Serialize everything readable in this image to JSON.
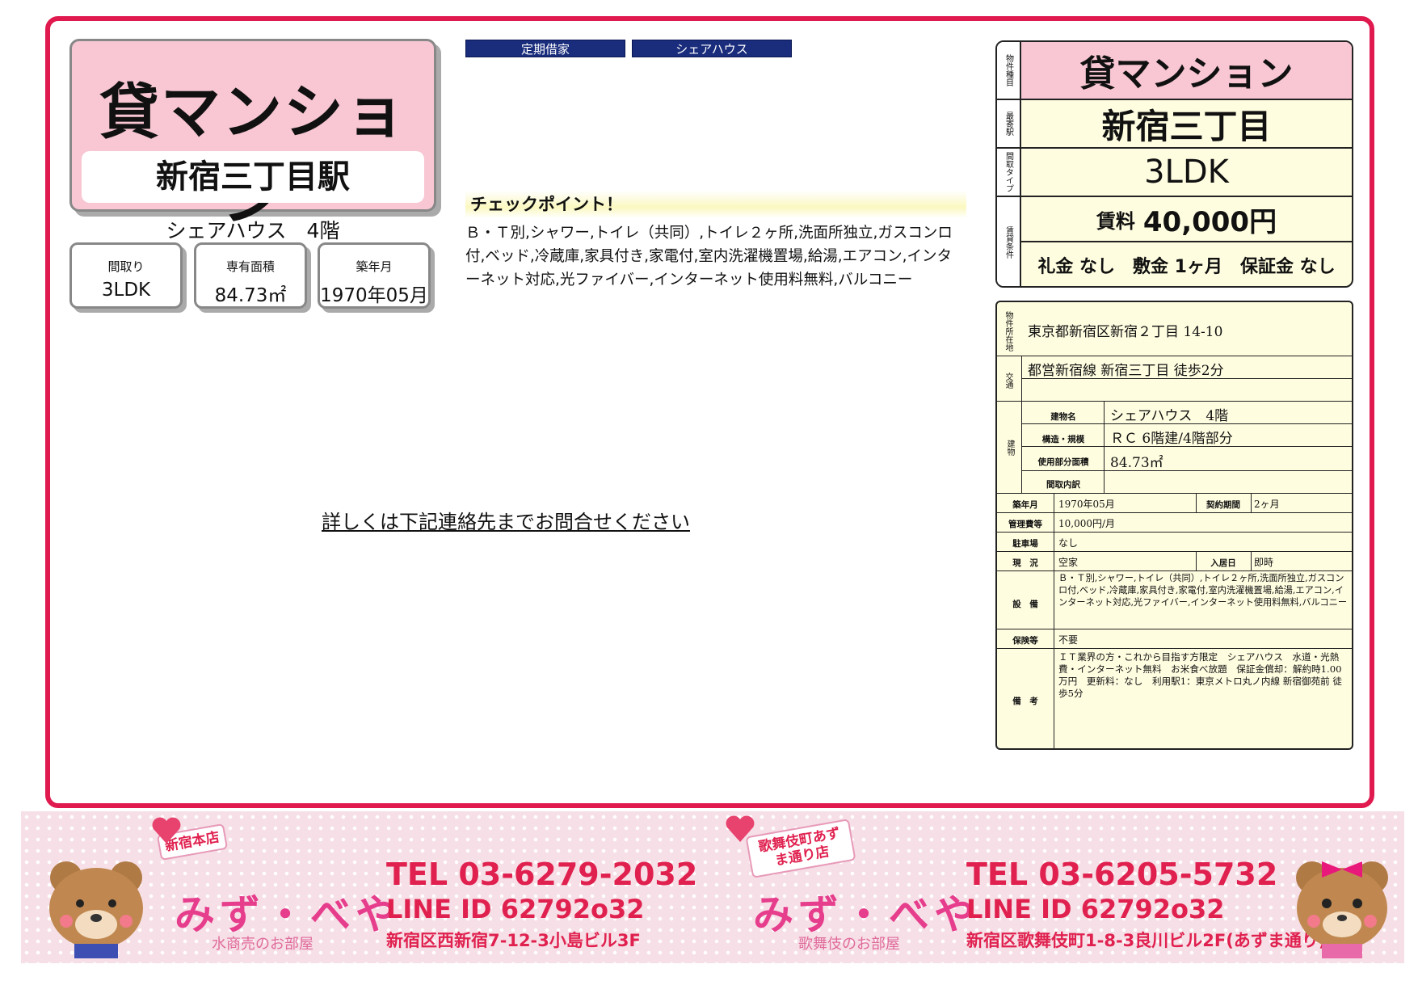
{
  "title": {
    "type": "貸マンション",
    "station": "新宿三丁目駅",
    "subtitle": "シェアハウス　4階"
  },
  "summary_boxes": [
    {
      "label": "間取り",
      "value": "3LDK"
    },
    {
      "label": "専有面積",
      "value": "84.73㎡"
    },
    {
      "label": "築年月",
      "value": "1970年05月"
    }
  ],
  "tags": [
    "定期借家",
    "シェアハウス"
  ],
  "checkpoint": {
    "heading": "チェックポイント！",
    "text": "Ｂ・Ｔ別,シャワー,トイレ（共同）,トイレ２ヶ所,洗面所独立,ガスコンロ付,ベッド,冷蔵庫,家具付き,家電付,室内洗濯機置場,給湯,エアコン,インターネット対応,光ファイバー,インターネット使用料無料,バルコニー"
  },
  "contact_note": "詳しくは下記連絡先までお問合せください",
  "right_summary": {
    "labels": [
      "物件種目",
      "最寄駅",
      "間取タイプ",
      "賃貸条件"
    ],
    "type": "貸マンション",
    "station": "新宿三丁目",
    "layout": "3LDK",
    "rent_label": "賃料",
    "rent_value": "40,000円",
    "conditions": "礼金 なし　敷金 1ヶ月　保証金 なし"
  },
  "details": {
    "address_label": "物件所在地",
    "address": "東京都新宿区新宿２丁目 14-10",
    "transport_label": "交通",
    "transport": "都営新宿線 新宿三丁目 徒歩2分",
    "building_label": "建物",
    "building_name_label": "建物名",
    "building_name": "シェアハウス　4階",
    "structure_label": "構造・規模",
    "structure": "ＲＣ 6階建/4階部分",
    "area_label": "使用部分面積",
    "area": "84.73㎡",
    "layout_detail_label": "間取内訳",
    "built_label": "築年月",
    "built": "1970年05月",
    "contract_label": "契約期間",
    "contract": "2ヶ月",
    "mgmt_label": "管理費等",
    "mgmt": "10,000円/月",
    "parking_label": "駐車場",
    "parking": "なし",
    "status_label": "現　況",
    "status": "空家",
    "movein_label": "入居日",
    "movein": "即時",
    "equipment_label": "設　備",
    "equipment": "Ｂ・Ｔ別,シャワー,トイレ（共同）,トイレ２ヶ所,洗面所独立,ガスコンロ付,ベッド,冷蔵庫,家具付き,家電付,室内洗濯機置場,給湯,エアコン,インターネット対応,光ファイバー,インターネット使用料無料,バルコニー",
    "insurance_label": "保険等",
    "insurance": "不要",
    "remarks_label": "備　考",
    "remarks": "ＩＴ業界の方・これから目指す方限定　シェアハウス　水道・光熱費・インターネット無料　お米食べ放題　保証金償却：解約時1.00万円　更新料：なし　利用駅1：東京メトロ丸ノ内線 新宿御苑前 徒歩5分"
  },
  "footer": {
    "shops": [
      {
        "badge": "新宿本店",
        "brand": "みず・べや",
        "brand_sub": "水商売のお部屋",
        "tel": "TEL 03-6279-2032",
        "line": "LINE ID 62792o32",
        "address": "新宿区西新宿7-12-3小島ビル3F"
      },
      {
        "badge": "歌舞伎町あずま通り店",
        "brand": "みず・べや",
        "brand_sub": "歌舞伎のお部屋",
        "tel": "TEL 03-6205-5732",
        "line": "LINE ID 62792o32",
        "address": "新宿区歌舞伎町1-8-3良川ビル2F(あずま通り)"
      }
    ],
    "accent": "#e0214f"
  }
}
